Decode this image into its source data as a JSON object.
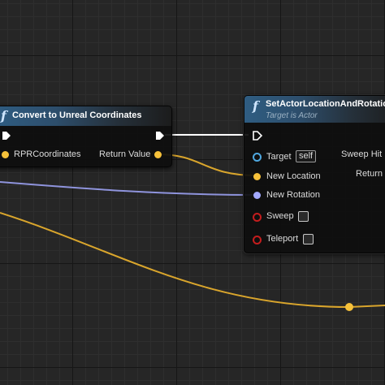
{
  "colors": {
    "exec": "#ffffff",
    "vector": "#f6c13a",
    "rotator": "#a3a9ff",
    "object": "#4fa8e0",
    "bool": "#c41d1d"
  },
  "nodes": {
    "convert": {
      "icon": "function-icon",
      "title": "Convert to Unreal Coordinates",
      "inputs": {
        "exec": "exec-in",
        "rpr_coordinates": "RPRCoordinates"
      },
      "outputs": {
        "exec": "exec-out",
        "return_value": "Return Value"
      }
    },
    "set_actor": {
      "icon": "function-icon",
      "title": "SetActorLocationAndRotation",
      "subtitle": "Target is Actor",
      "inputs": {
        "target": "Target",
        "target_default": "self",
        "new_location": "New Location",
        "new_rotation": "New Rotation",
        "sweep": "Sweep",
        "teleport": "Teleport"
      },
      "outputs": {
        "sweep_hit_result": "Sweep Hit R",
        "return_value": "Return V"
      }
    }
  }
}
